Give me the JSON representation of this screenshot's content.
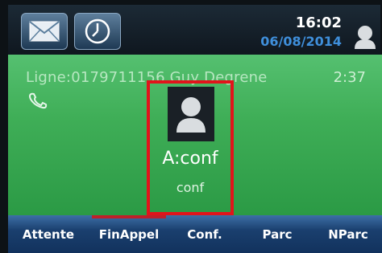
{
  "header": {
    "time": "16:02",
    "date": "06/08/2014",
    "icons": [
      "messages-icon",
      "clock-icon",
      "user-icon"
    ]
  },
  "call": {
    "line": "Ligne:0179711156 Guy Degrene",
    "duration": "2:37",
    "status_icon": "handset-icon",
    "contact_name": "A:conf",
    "contact_sub": "conf",
    "highlight_color": "#e1141b"
  },
  "softkeys": [
    "Attente",
    "FinAppel",
    "Conf.",
    "Parc",
    "NParc"
  ],
  "colors": {
    "call_bg": "#3fae57",
    "softkey_bg": "#1a3f6e",
    "date_blue": "#3f8fdb"
  }
}
